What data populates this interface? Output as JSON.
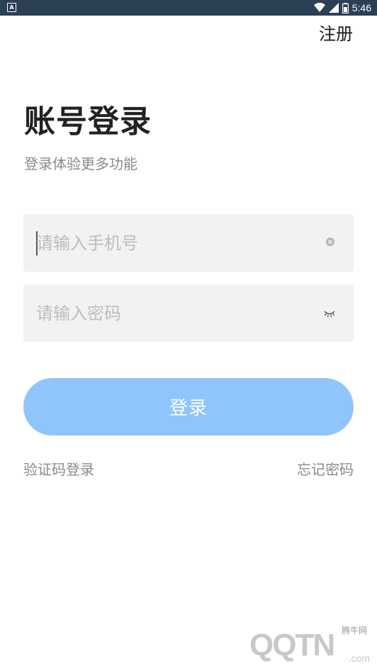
{
  "status_bar": {
    "time": "5:46"
  },
  "header": {
    "register_label": "注册"
  },
  "main": {
    "title": "账号登录",
    "subtitle": "登录体验更多功能",
    "phone": {
      "placeholder": "请输入手机号",
      "value": ""
    },
    "password": {
      "placeholder": "请输入密码",
      "value": ""
    },
    "login_label": "登录",
    "sms_login_label": "验证码登录",
    "forgot_password_label": "忘记密码"
  },
  "watermark": {
    "brand": "QQTN",
    "cn": "腾牛网",
    "domain": ".com"
  },
  "colors": {
    "status_bar": "#2b3f55",
    "button": "#90c5fb",
    "field_bg": "#f2f2f2"
  }
}
